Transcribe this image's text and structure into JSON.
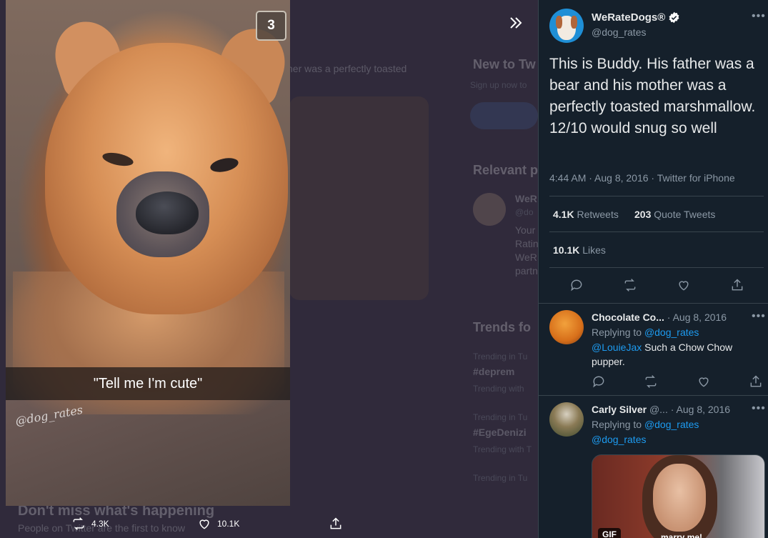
{
  "viewer": {
    "photo_count_badge": "3",
    "photo_caption": "\"Tell me I'm cute\"",
    "photo_watermark": "@dog_rates",
    "retweet_count": "4.3K",
    "like_count": "10.1K",
    "background_texts": {
      "snippet": "her was a perfectly toasted",
      "new_to": "New to Tw",
      "signup": "Sign up now to",
      "relevant": "Relevant p",
      "we": "WeR",
      "handle": "@do",
      "your": "Your",
      "rati": "Ratin",
      "wer2": "WeR",
      "part": "partn",
      "trends": "Trends fo",
      "trend1_label": "Trending in Tu",
      "trend1": "#deprem",
      "trend1_sub": "Trending with ",
      "trend2_label": "Trending in Tu",
      "trend2": "#EgeDenizi",
      "trend2_sub": "Trending with T",
      "trend3_label": "Trending in Tu",
      "bottom_banner": "Don't miss what's happening",
      "bottom_sub": "People on Twitter are the first to know"
    }
  },
  "tweet": {
    "author_name": "WeRateDogs®",
    "author_handle": "@dog_rates",
    "text": "This is Buddy. His father was a bear and his mother was a perfectly toasted marshmallow. 12/10 would snug so well",
    "meta": "4:44 AM · Aug 8, 2016 · Twitter for iPhone",
    "retweets_count": "4.1K",
    "retweets_label": "Retweets",
    "quote_count": "203",
    "quote_label": "Quote Tweets",
    "likes_count": "10.1K",
    "likes_label": "Likes"
  },
  "replies": [
    {
      "name": "Chocolate Co...",
      "date": "· Aug 8, 2016",
      "replying_label": "Replying to",
      "replying_to": "@dog_rates",
      "mention": "@LouieJax",
      "body": "Such a Chow Chow pupper."
    },
    {
      "name": "Carly Silver",
      "handle": "@...",
      "date": "· Aug 8, 2016",
      "replying_label": "Replying to",
      "replying_to": "@dog_rates",
      "mention": "@dog_rates",
      "gif_badge": "GIF",
      "gif_caption": "marry me!"
    }
  ],
  "colors": {
    "panel_bg": "#15202b",
    "accent": "#1d9bf0",
    "muted": "#8b98a5"
  }
}
